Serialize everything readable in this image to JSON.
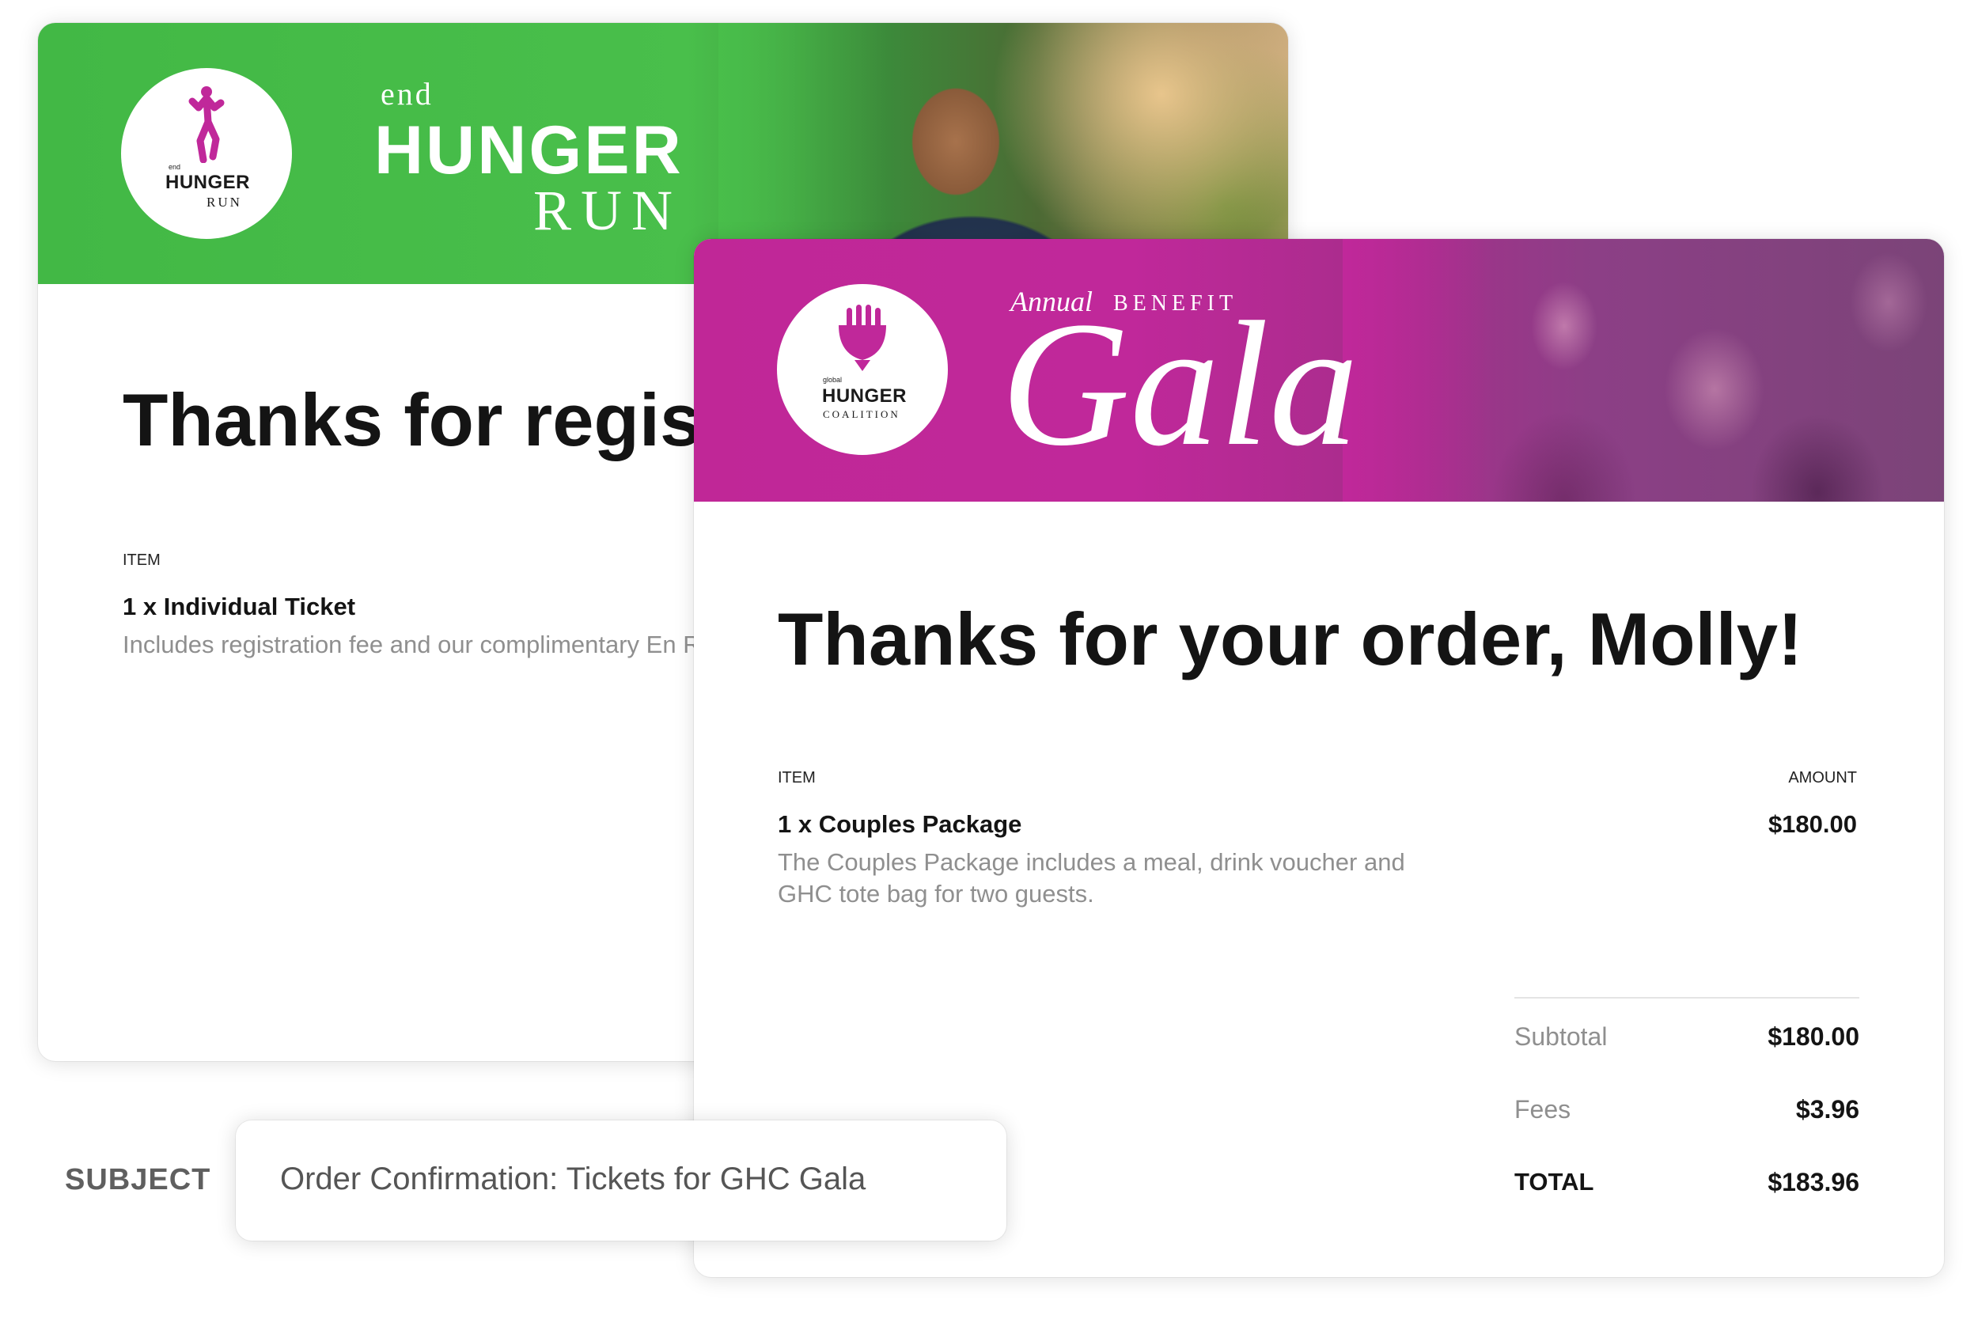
{
  "run_email": {
    "brand_color": "#49bf4b",
    "logo": {
      "small_top": "end",
      "small_middle": "HUNGER",
      "small_bottom": "RUN"
    },
    "banner": {
      "line1": "end",
      "line2": "HUNGER",
      "line3": "RUN"
    },
    "heading": "Thanks for registe",
    "item_header": "ITEM",
    "item": {
      "name": "1 x Individual Ticket",
      "description": "Includes registration fee and our complimentary En Run t-shirt."
    }
  },
  "gala_email": {
    "brand_color": "#c0289a",
    "logo": {
      "small_top": "global",
      "small_middle": "HUNGER",
      "small_bottom": "COALITION"
    },
    "banner": {
      "annual": "Annual",
      "benefit": "BENEFIT",
      "title": "Gala"
    },
    "heading": "Thanks for your order, Molly!",
    "item_header": "ITEM",
    "amount_header": "AMOUNT",
    "item": {
      "name": "1 x Couples Package",
      "price": "$180.00",
      "description": "The Couples Package includes a meal, drink voucher and GHC tote bag for two guests."
    },
    "summary": {
      "subtotal_label": "Subtotal",
      "subtotal_value": "$180.00",
      "fees_label": "Fees",
      "fees_value": "$3.96",
      "total_label": "TOTAL",
      "total_value": "$183.96"
    }
  },
  "subject": {
    "label": "SUBJECT",
    "value": "Order Confirmation: Tickets for GHC Gala"
  }
}
